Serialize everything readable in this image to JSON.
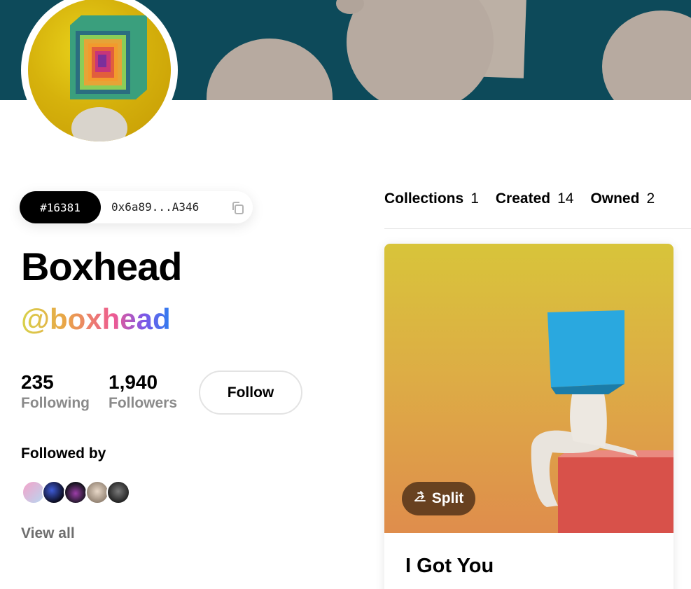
{
  "profile": {
    "token_id": "#16381",
    "address": "0x6a89...A346",
    "display_name": "Boxhead",
    "handle": "@boxhead"
  },
  "stats": {
    "following_count": "235",
    "following_label": "Following",
    "followers_count": "1,940",
    "followers_label": "Followers"
  },
  "follow_button": {
    "label": "Follow"
  },
  "followed_by": {
    "title": "Followed by",
    "view_all": "View all",
    "avatars": [
      "follower-avatar-1",
      "follower-avatar-2",
      "follower-avatar-3",
      "follower-avatar-4",
      "follower-avatar-5"
    ]
  },
  "tabs": [
    {
      "label": "Collections",
      "count": "1"
    },
    {
      "label": "Created",
      "count": "14"
    },
    {
      "label": "Owned",
      "count": "2"
    }
  ],
  "card": {
    "badge_label": "Split",
    "title": "I Got You"
  },
  "icons": {
    "copy": "copy-icon",
    "split": "split-icon"
  },
  "colors": {
    "cover_bg": "#0d4a5a",
    "handle_gradient": [
      "#d7d24a",
      "#e9a447",
      "#ee5a92",
      "#7e57e8",
      "#2d7ef0"
    ],
    "muted_text": "#8a8a8a"
  }
}
